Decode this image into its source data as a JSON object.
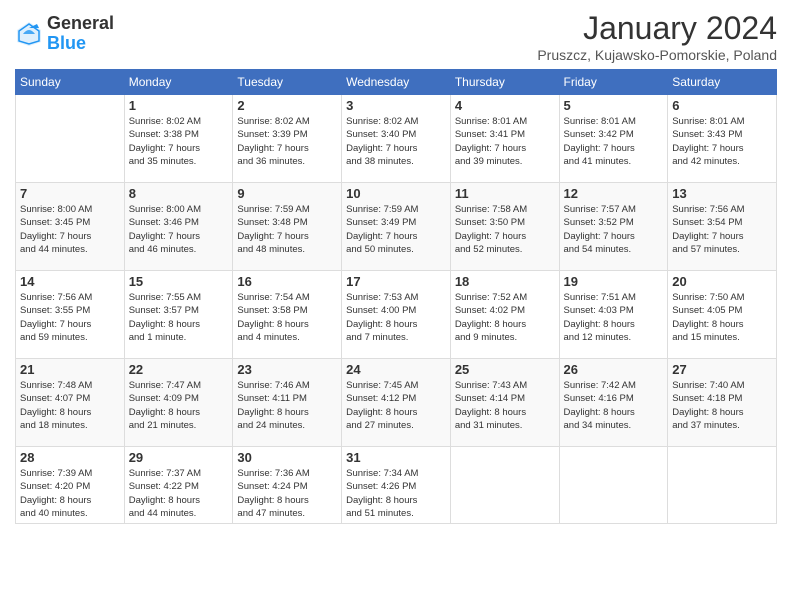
{
  "header": {
    "logo_general": "General",
    "logo_blue": "Blue",
    "month_title": "January 2024",
    "location": "Pruszcz, Kujawsko-Pomorskie, Poland"
  },
  "weekdays": [
    "Sunday",
    "Monday",
    "Tuesday",
    "Wednesday",
    "Thursday",
    "Friday",
    "Saturday"
  ],
  "weeks": [
    [
      {
        "day": "",
        "info": ""
      },
      {
        "day": "1",
        "info": "Sunrise: 8:02 AM\nSunset: 3:38 PM\nDaylight: 7 hours\nand 35 minutes."
      },
      {
        "day": "2",
        "info": "Sunrise: 8:02 AM\nSunset: 3:39 PM\nDaylight: 7 hours\nand 36 minutes."
      },
      {
        "day": "3",
        "info": "Sunrise: 8:02 AM\nSunset: 3:40 PM\nDaylight: 7 hours\nand 38 minutes."
      },
      {
        "day": "4",
        "info": "Sunrise: 8:01 AM\nSunset: 3:41 PM\nDaylight: 7 hours\nand 39 minutes."
      },
      {
        "day": "5",
        "info": "Sunrise: 8:01 AM\nSunset: 3:42 PM\nDaylight: 7 hours\nand 41 minutes."
      },
      {
        "day": "6",
        "info": "Sunrise: 8:01 AM\nSunset: 3:43 PM\nDaylight: 7 hours\nand 42 minutes."
      }
    ],
    [
      {
        "day": "7",
        "info": "Sunrise: 8:00 AM\nSunset: 3:45 PM\nDaylight: 7 hours\nand 44 minutes."
      },
      {
        "day": "8",
        "info": "Sunrise: 8:00 AM\nSunset: 3:46 PM\nDaylight: 7 hours\nand 46 minutes."
      },
      {
        "day": "9",
        "info": "Sunrise: 7:59 AM\nSunset: 3:48 PM\nDaylight: 7 hours\nand 48 minutes."
      },
      {
        "day": "10",
        "info": "Sunrise: 7:59 AM\nSunset: 3:49 PM\nDaylight: 7 hours\nand 50 minutes."
      },
      {
        "day": "11",
        "info": "Sunrise: 7:58 AM\nSunset: 3:50 PM\nDaylight: 7 hours\nand 52 minutes."
      },
      {
        "day": "12",
        "info": "Sunrise: 7:57 AM\nSunset: 3:52 PM\nDaylight: 7 hours\nand 54 minutes."
      },
      {
        "day": "13",
        "info": "Sunrise: 7:56 AM\nSunset: 3:54 PM\nDaylight: 7 hours\nand 57 minutes."
      }
    ],
    [
      {
        "day": "14",
        "info": "Sunrise: 7:56 AM\nSunset: 3:55 PM\nDaylight: 7 hours\nand 59 minutes."
      },
      {
        "day": "15",
        "info": "Sunrise: 7:55 AM\nSunset: 3:57 PM\nDaylight: 8 hours\nand 1 minute."
      },
      {
        "day": "16",
        "info": "Sunrise: 7:54 AM\nSunset: 3:58 PM\nDaylight: 8 hours\nand 4 minutes."
      },
      {
        "day": "17",
        "info": "Sunrise: 7:53 AM\nSunset: 4:00 PM\nDaylight: 8 hours\nand 7 minutes."
      },
      {
        "day": "18",
        "info": "Sunrise: 7:52 AM\nSunset: 4:02 PM\nDaylight: 8 hours\nand 9 minutes."
      },
      {
        "day": "19",
        "info": "Sunrise: 7:51 AM\nSunset: 4:03 PM\nDaylight: 8 hours\nand 12 minutes."
      },
      {
        "day": "20",
        "info": "Sunrise: 7:50 AM\nSunset: 4:05 PM\nDaylight: 8 hours\nand 15 minutes."
      }
    ],
    [
      {
        "day": "21",
        "info": "Sunrise: 7:48 AM\nSunset: 4:07 PM\nDaylight: 8 hours\nand 18 minutes."
      },
      {
        "day": "22",
        "info": "Sunrise: 7:47 AM\nSunset: 4:09 PM\nDaylight: 8 hours\nand 21 minutes."
      },
      {
        "day": "23",
        "info": "Sunrise: 7:46 AM\nSunset: 4:11 PM\nDaylight: 8 hours\nand 24 minutes."
      },
      {
        "day": "24",
        "info": "Sunrise: 7:45 AM\nSunset: 4:12 PM\nDaylight: 8 hours\nand 27 minutes."
      },
      {
        "day": "25",
        "info": "Sunrise: 7:43 AM\nSunset: 4:14 PM\nDaylight: 8 hours\nand 31 minutes."
      },
      {
        "day": "26",
        "info": "Sunrise: 7:42 AM\nSunset: 4:16 PM\nDaylight: 8 hours\nand 34 minutes."
      },
      {
        "day": "27",
        "info": "Sunrise: 7:40 AM\nSunset: 4:18 PM\nDaylight: 8 hours\nand 37 minutes."
      }
    ],
    [
      {
        "day": "28",
        "info": "Sunrise: 7:39 AM\nSunset: 4:20 PM\nDaylight: 8 hours\nand 40 minutes."
      },
      {
        "day": "29",
        "info": "Sunrise: 7:37 AM\nSunset: 4:22 PM\nDaylight: 8 hours\nand 44 minutes."
      },
      {
        "day": "30",
        "info": "Sunrise: 7:36 AM\nSunset: 4:24 PM\nDaylight: 8 hours\nand 47 minutes."
      },
      {
        "day": "31",
        "info": "Sunrise: 7:34 AM\nSunset: 4:26 PM\nDaylight: 8 hours\nand 51 minutes."
      },
      {
        "day": "",
        "info": ""
      },
      {
        "day": "",
        "info": ""
      },
      {
        "day": "",
        "info": ""
      }
    ]
  ]
}
